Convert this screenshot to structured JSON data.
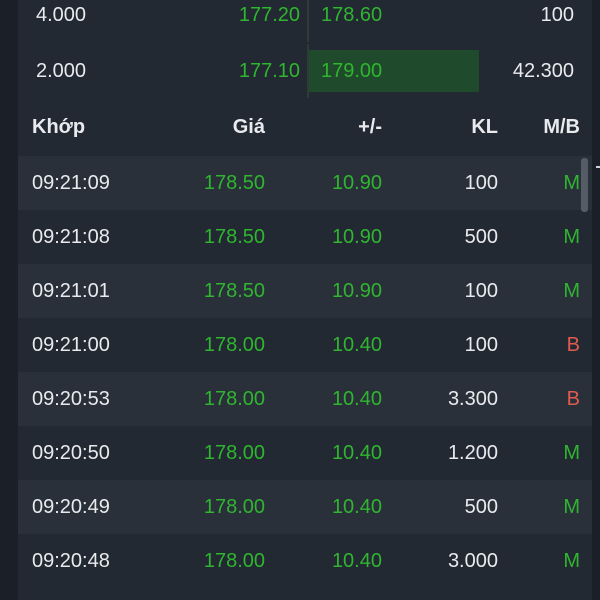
{
  "order_book": [
    {
      "bid_volume": "4.000",
      "bid_price": "177.20",
      "ask_price": "178.60",
      "ask_volume": "100",
      "ask_depth": 0
    },
    {
      "bid_volume": "2.000",
      "bid_price": "177.10",
      "ask_price": "179.00",
      "ask_volume": "42.300",
      "ask_depth": 1
    }
  ],
  "trades_header": {
    "match": "Khớp",
    "price": "Giá",
    "change": "+/-",
    "volume": "KL",
    "side": "M/B"
  },
  "trades": [
    {
      "time": "09:21:09",
      "price": "178.50",
      "change": "10.90",
      "volume": "100",
      "side": "M"
    },
    {
      "time": "09:21:08",
      "price": "178.50",
      "change": "10.90",
      "volume": "500",
      "side": "M"
    },
    {
      "time": "09:21:01",
      "price": "178.50",
      "change": "10.90",
      "volume": "100",
      "side": "M"
    },
    {
      "time": "09:21:00",
      "price": "178.00",
      "change": "10.40",
      "volume": "100",
      "side": "B"
    },
    {
      "time": "09:20:53",
      "price": "178.00",
      "change": "10.40",
      "volume": "3.300",
      "side": "B"
    },
    {
      "time": "09:20:50",
      "price": "178.00",
      "change": "10.40",
      "volume": "1.200",
      "side": "M"
    },
    {
      "time": "09:20:49",
      "price": "178.00",
      "change": "10.40",
      "volume": "500",
      "side": "M"
    },
    {
      "time": "09:20:48",
      "price": "178.00",
      "change": "10.40",
      "volume": "3.000",
      "side": "M"
    }
  ],
  "colors": {
    "up": "#2fb52f",
    "sell": "#e05a4f",
    "background": "#1b1f27",
    "panel": "#232932",
    "row_alt": "#2a303a"
  }
}
